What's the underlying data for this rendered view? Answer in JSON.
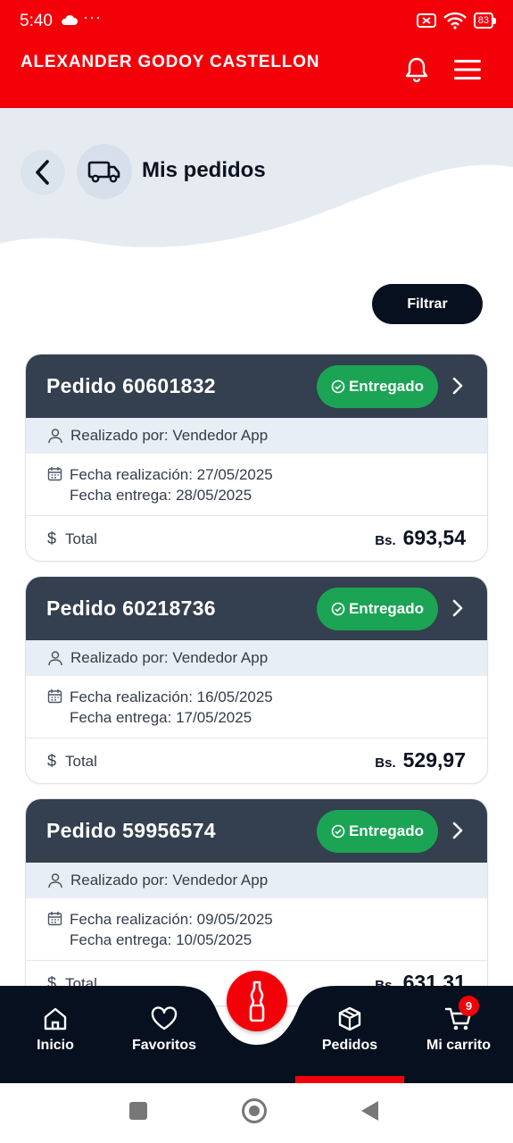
{
  "status_bar": {
    "time": "5:40",
    "dots": "···",
    "battery": "83"
  },
  "app_bar": {
    "user_name": "ALEXANDER GODOY CASTELLON"
  },
  "header": {
    "title": "Mis pedidos"
  },
  "filter": {
    "label": "Filtrar"
  },
  "orders": [
    {
      "title": "Pedido 60601832",
      "status": "Entregado",
      "made_by": "Realizado por: Vendedor App",
      "order_date": "Fecha realización: 27/05/2025",
      "delivery_date": "Fecha entrega: 28/05/2025",
      "total_label": "Total",
      "currency": "Bs.",
      "total": "693,54"
    },
    {
      "title": "Pedido 60218736",
      "status": "Entregado",
      "made_by": "Realizado por: Vendedor App",
      "order_date": "Fecha realización: 16/05/2025",
      "delivery_date": "Fecha entrega: 17/05/2025",
      "total_label": "Total",
      "currency": "Bs.",
      "total": "529,97"
    },
    {
      "title": "Pedido 59956574",
      "status": "Entregado",
      "made_by": "Realizado por: Vendedor App",
      "order_date": "Fecha realización: 09/05/2025",
      "delivery_date": "Fecha entrega: 10/05/2025",
      "total_label": "Total",
      "currency": "Bs.",
      "total": "631,31"
    }
  ],
  "bottom_nav": {
    "items": [
      {
        "label": "Inicio",
        "icon": "home-icon"
      },
      {
        "label": "Favoritos",
        "icon": "heart-icon"
      },
      {
        "label": "Pedidos",
        "icon": "box-icon",
        "active": true
      },
      {
        "label": "Mi carrito",
        "icon": "cart-icon"
      }
    ],
    "cart_count": "9",
    "center_icon": "bottle-icon"
  },
  "colors": {
    "brand_red": "#f40009",
    "header_dark": "#343f4f",
    "nav_dark": "#07101e",
    "status_green": "#1aa454"
  }
}
